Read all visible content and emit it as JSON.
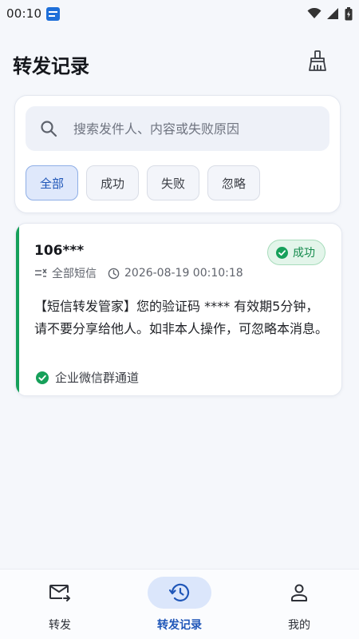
{
  "status_bar": {
    "time": "00:10"
  },
  "header": {
    "title": "转发记录"
  },
  "search": {
    "placeholder": "搜索发件人、内容或失败原因"
  },
  "filters": [
    {
      "label": "全部",
      "active": true
    },
    {
      "label": "成功",
      "active": false
    },
    {
      "label": "失败",
      "active": false
    },
    {
      "label": "忽略",
      "active": false
    }
  ],
  "records": [
    {
      "sender": "106***",
      "status": "成功",
      "sim": "全部短信",
      "timestamp": "2026-08-19 00:10:18",
      "content": "【短信转发管家】您的验证码 **** 有效期5分钟，请不要分享给他人。如非本人操作，可忽略本消息。",
      "channel": "企业微信群通道"
    }
  ],
  "bottom_nav": [
    {
      "label": "转发",
      "icon": "mail-forward-icon",
      "active": false
    },
    {
      "label": "转发记录",
      "icon": "history-icon",
      "active": true
    },
    {
      "label": "我的",
      "icon": "person-icon",
      "active": false
    }
  ],
  "colors": {
    "accent": "#1f56b8",
    "success": "#16a05a",
    "background": "#f5f7fb"
  }
}
